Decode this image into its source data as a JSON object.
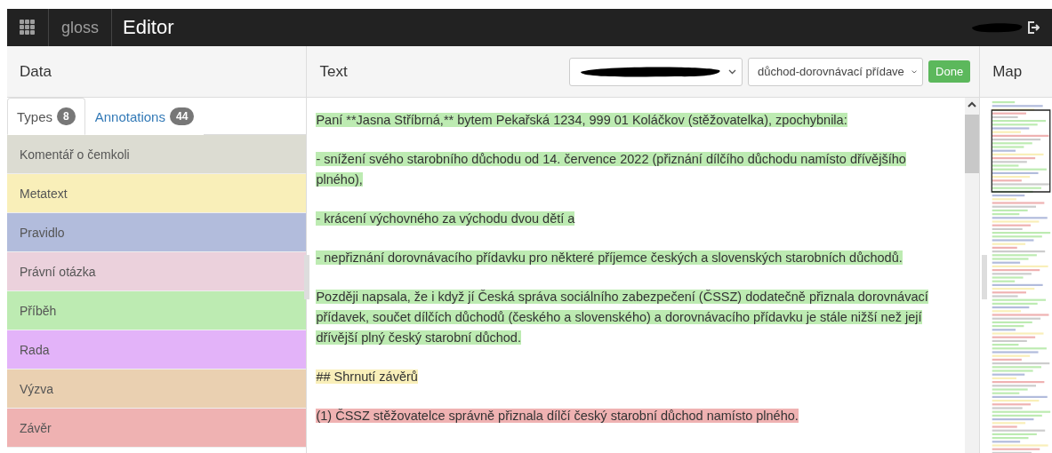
{
  "header": {
    "app": "gloss",
    "title": "Editor"
  },
  "data_panel": {
    "title": "Data",
    "tabs": [
      {
        "label": "Types",
        "count": "8",
        "selected": true
      },
      {
        "label": "Annotations",
        "count": "44",
        "selected": false
      }
    ],
    "types": [
      {
        "label": "Komentář o čemkoli",
        "color": "#dcdcd2"
      },
      {
        "label": "Metatext",
        "color": "#f9efb9"
      },
      {
        "label": "Pravidlo",
        "color": "#b2bcdc"
      },
      {
        "label": "Právní otázka",
        "color": "#ebd1dc"
      },
      {
        "label": "Příběh",
        "color": "#bdebb2"
      },
      {
        "label": "Rada",
        "color": "#e3b3f9"
      },
      {
        "label": "Výzva",
        "color": "#ead0b1"
      },
      {
        "label": "Závěr",
        "color": "#efb2b2"
      }
    ]
  },
  "text_panel": {
    "title": "Text",
    "section_select": {
      "value": "důchod-dorovnávací přídave"
    },
    "done_button": "Done",
    "paragraphs": [
      {
        "text": "Paní **Jasna Stříbrná,** bytem Pekařská 1234, 999 01 Koláčkov (stěžovatelka), zpochybnila:",
        "color": "#bdebb2"
      },
      {
        "text": "-   snížení svého starobního důchodu od 14. července 2022 (přiznání dílčího důchodu namísto dřívějšího plného),",
        "color": "#bdebb2"
      },
      {
        "text": "-   krácení výchovného za východu dvou dětí a",
        "color": "#bdebb2"
      },
      {
        "text": "-   nepřiznání dorovnávacího přídavku pro některé příjemce českých a slovenských starobních důchodů.",
        "color": "#bdebb2"
      },
      {
        "text": "Později napsala, že i když jí Česká správa sociálního zabezpečení (ČSSZ) dodatečně přiznala dorovnávací přídavek, součet dílčích důchodů (českého a slovenského) a dorovnávacího přídavku je stále nižší než její dřívější plný český starobní důchod.",
        "color": "#bdebb2"
      },
      {
        "text": "## Shrnutí závěrů",
        "color": "#f9efb9"
      },
      {
        "text": "(1) ČSSZ stěžovatelce správně přiznala dílčí český starobní důchod namísto plného.",
        "color": "#efb2b2"
      }
    ]
  },
  "map_panel": {
    "title": "Map"
  }
}
